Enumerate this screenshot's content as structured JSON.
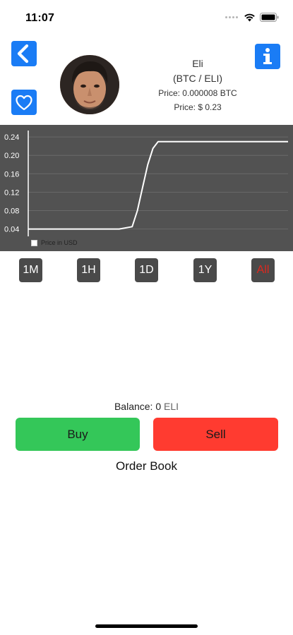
{
  "status_bar": {
    "time": "11:07"
  },
  "header": {
    "coin_name": "Eli",
    "pair": "(BTC / ELI)",
    "price_btc": "Price: 0.000008 BTC",
    "price_usd": "Price: $ 0.23"
  },
  "chart_data": {
    "type": "line",
    "y_ticks": [
      "0.24",
      "0.20",
      "0.16",
      "0.12",
      "0.08",
      "0.04"
    ],
    "ylim": [
      0.024,
      0.254
    ],
    "grid": true,
    "series": [
      {
        "x": [
          0,
          0.35,
          0.4,
          0.42,
          0.44,
          0.46,
          0.48,
          0.5,
          1.0
        ],
        "values": [
          0.04,
          0.04,
          0.045,
          0.08,
          0.13,
          0.18,
          0.215,
          0.23,
          0.23
        ],
        "color": "#ffffff"
      }
    ],
    "usd_toggle_label": "Price in USD",
    "usd_toggle_checked": false
  },
  "periods": [
    {
      "label": "1M",
      "active": false
    },
    {
      "label": "1H",
      "active": false
    },
    {
      "label": "1D",
      "active": false
    },
    {
      "label": "1Y",
      "active": false
    },
    {
      "label": "All",
      "active": true
    }
  ],
  "trade": {
    "balance_label": "Balance: 0",
    "balance_unit": "ELI",
    "buy_label": "Buy",
    "sell_label": "Sell",
    "order_book_label": "Order Book"
  },
  "colors": {
    "accent_blue": "#1a7cf5",
    "buy_green": "#34c759",
    "sell_red": "#ff3b30",
    "chart_bg": "#525252",
    "active_period": "#e0281e"
  },
  "icons": {
    "back": "chevron-left-icon",
    "info": "info-icon",
    "favorite": "heart-outline-icon"
  }
}
